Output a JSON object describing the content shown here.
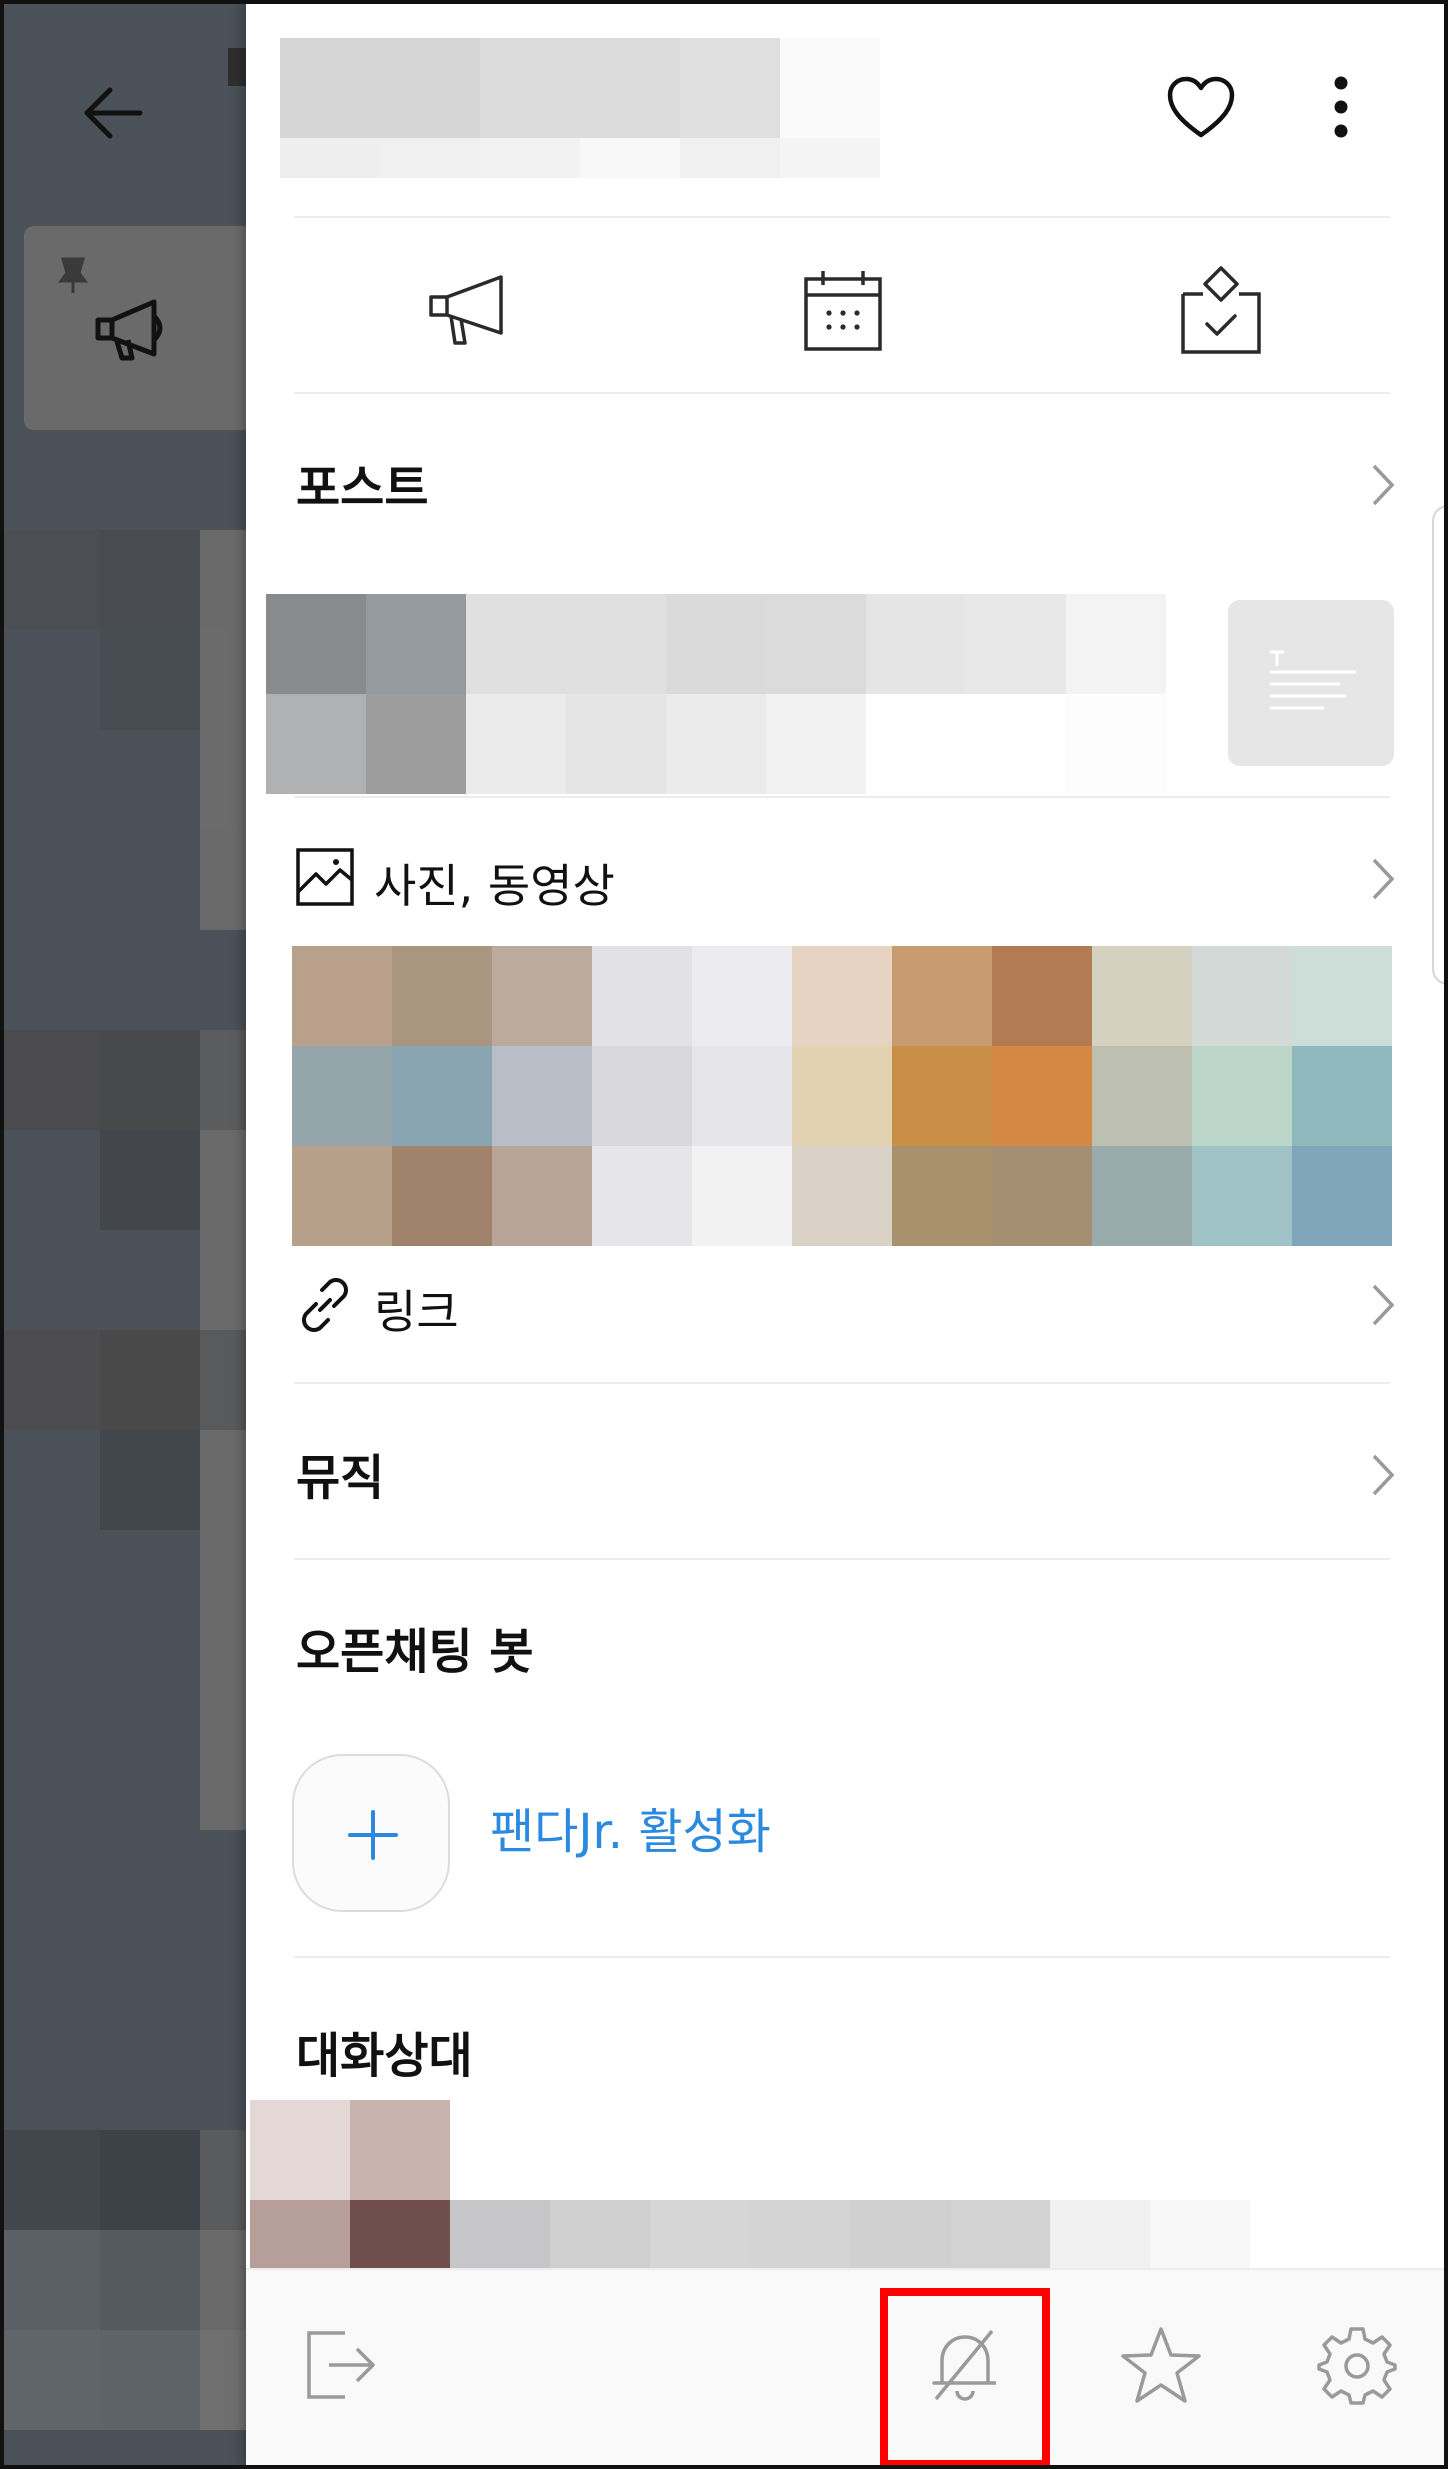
{
  "drawer": {
    "header": {
      "favorite_icon": "heart-icon",
      "more_icon": "more-vertical-icon"
    },
    "shortcuts": [
      {
        "icon": "megaphone-icon"
      },
      {
        "icon": "calendar-icon"
      },
      {
        "icon": "vote-box-icon"
      }
    ],
    "sections": {
      "post": "포스트",
      "media": "사진, 동영상",
      "link": "링크",
      "music": "뮤직",
      "openchat_bot": "오픈채팅 봇",
      "bot_action": "팬다Jr. 활성화",
      "participants": "대화상대"
    },
    "bottom_bar": {
      "leave_icon": "exit-icon",
      "mute_icon": "bell-off-icon",
      "star_icon": "star-icon",
      "settings_icon": "gear-icon"
    }
  },
  "colors": {
    "link_accent": "#2b8ae0",
    "highlight": "#ff0000"
  }
}
